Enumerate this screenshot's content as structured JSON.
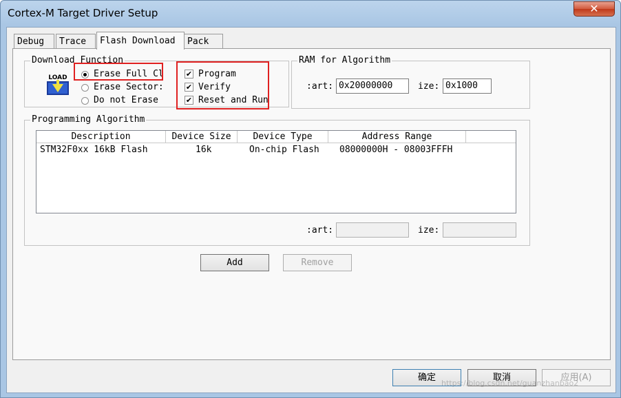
{
  "window": {
    "title": "Cortex-M Target Driver Setup",
    "close_glyph": "✕"
  },
  "tabs": [
    {
      "label": "Debug",
      "active": false
    },
    {
      "label": "Trace",
      "active": false
    },
    {
      "label": "Flash Download",
      "active": true
    },
    {
      "label": "Pack",
      "active": false
    }
  ],
  "download_function": {
    "title": "Download Function",
    "icon": "load-icon",
    "icon_text": "LOAD",
    "erase_options": [
      {
        "label": "Erase Full Cl",
        "selected": true
      },
      {
        "label": "Erase Sector:",
        "selected": false
      },
      {
        "label": "Do not Erase",
        "selected": false
      }
    ],
    "checkboxes": [
      {
        "label": "Program",
        "checked": true
      },
      {
        "label": "Verify",
        "checked": true
      },
      {
        "label": "Reset and Run",
        "checked": true
      }
    ],
    "check_glyph": "✔"
  },
  "ram": {
    "title": "RAM for Algorithm",
    "start_label": ":art:",
    "start_value": "0x20000000",
    "size_label": "ize:",
    "size_value": "0x1000"
  },
  "programming_algorithm": {
    "title": "Programming Algorithm",
    "columns": [
      "Description",
      "Device Size",
      "Device Type",
      "Address Range"
    ],
    "rows": [
      [
        "STM32F0xx 16kB Flash",
        "16k",
        "On-chip Flash",
        "08000000H - 08003FFFH"
      ]
    ],
    "start_label": ":art:",
    "start_value": "",
    "size_label": "ize:",
    "size_value": ""
  },
  "buttons": {
    "add": "Add",
    "remove": "Remove",
    "ok": "确定",
    "cancel": "取消",
    "apply": "应用(A)"
  },
  "watermark": "https://blog.csdn.net/guanzhanbao2"
}
